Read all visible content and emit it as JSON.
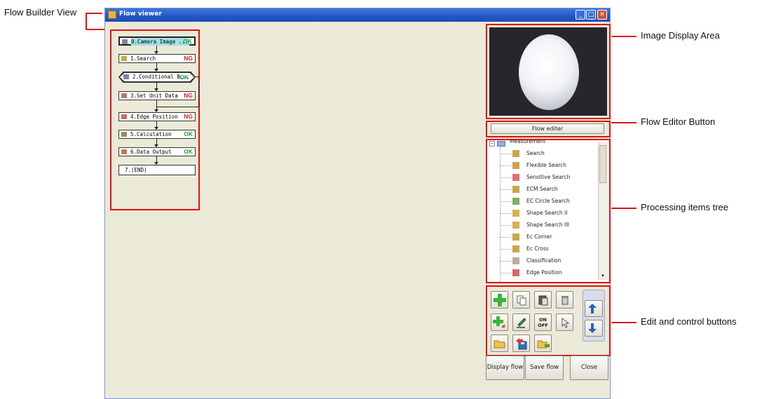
{
  "callouts": {
    "flow_builder_view": "Flow Builder View",
    "image_display_area": "Image Display Area",
    "flow_editor_button": "Flow Editor Button",
    "processing_items_tree": "Processing items tree",
    "edit_and_control_buttons": "Edit and control buttons"
  },
  "window": {
    "title": "Flow viewer",
    "minimize_glyph": "_",
    "maximize_glyph": "□",
    "close_glyph": "✕"
  },
  "flow": {
    "items": [
      {
        "label": "0.Camera Image ...",
        "status": "OK",
        "icon": "camera-icon"
      },
      {
        "label": "1.Search",
        "status": "NG",
        "icon": "search-item-icon"
      },
      {
        "label": "2.Conditional B...",
        "status": "OK",
        "icon": "branch-icon"
      },
      {
        "label": "3.Set Unit Data",
        "status": "NG",
        "icon": "unit-data-icon"
      },
      {
        "label": "4.Edge Position",
        "status": "NG",
        "icon": "edge-position-icon"
      },
      {
        "label": "5.Calculation",
        "status": "OK",
        "icon": "calculator-icon"
      },
      {
        "label": "6.Data Output",
        "status": "OK",
        "icon": "data-output-icon"
      },
      {
        "label": "7.(END)",
        "status": "",
        "icon": ""
      }
    ]
  },
  "flow_editor": {
    "label": "Flow editer"
  },
  "tree": {
    "root_label": "Measurement",
    "expander": "−",
    "items": [
      {
        "label": "Search",
        "icon": "search-item-icon"
      },
      {
        "label": "Flexible Search",
        "icon": "flexible-search-icon"
      },
      {
        "label": "Sensitive Search",
        "icon": "sensitive-search-icon"
      },
      {
        "label": "ECM Search",
        "icon": "ecm-search-icon"
      },
      {
        "label": "EC Circle Search",
        "icon": "ec-circle-search-icon"
      },
      {
        "label": "Shape Search II",
        "icon": "shape-search-icon"
      },
      {
        "label": "Shape Search III",
        "icon": "shape-search-icon"
      },
      {
        "label": "Ec Corner",
        "icon": "ec-corner-icon"
      },
      {
        "label": "Ec Cross",
        "icon": "ec-cross-icon"
      },
      {
        "label": "Classification",
        "icon": "classification-icon"
      },
      {
        "label": "Edge Position",
        "icon": "edge-position-icon"
      }
    ],
    "scroll_down_glyph": "▼"
  },
  "edit_buttons": {
    "toggle_on": "ON",
    "toggle_off": "OFF"
  },
  "bottom_buttons": {
    "display_flow": "Display flow",
    "save_flow": "Save flow",
    "close": "Close"
  },
  "colors": {
    "callout_red": "#dd1111",
    "ok_green": "#2b9a3a",
    "ng_red": "#e01b1b",
    "title_blue": "#2257c5"
  }
}
